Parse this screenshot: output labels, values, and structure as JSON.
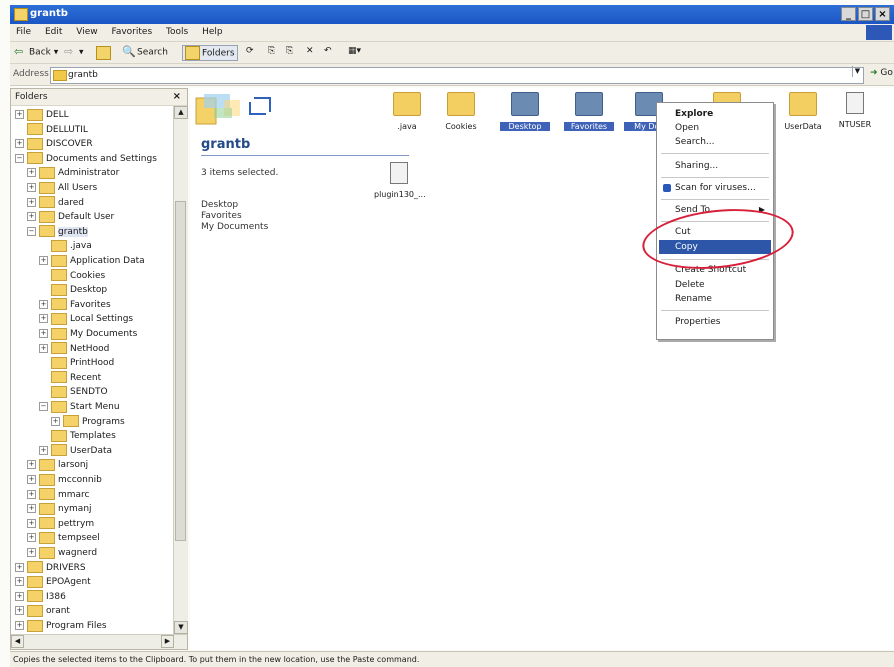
{
  "window": {
    "title": "grantb"
  },
  "menu": [
    "File",
    "Edit",
    "View",
    "Favorites",
    "Tools",
    "Help"
  ],
  "toolbar": {
    "back": "Back",
    "search": "Search",
    "folders": "Folders",
    "views_label": "Views"
  },
  "address": {
    "label": "Address",
    "value": "grantb",
    "go": "Go"
  },
  "folders_pane": {
    "header": "Folders",
    "close": "×",
    "items": [
      {
        "label": "DELL",
        "depth": 0,
        "pm": "+"
      },
      {
        "label": "DELLUTIL",
        "depth": 0,
        "pm": ""
      },
      {
        "label": "DISCOVER",
        "depth": 0,
        "pm": "+"
      },
      {
        "label": "Documents and Settings",
        "depth": 0,
        "pm": "-"
      },
      {
        "label": "Administrator",
        "depth": 1,
        "pm": "+"
      },
      {
        "label": "All Users",
        "depth": 1,
        "pm": "+"
      },
      {
        "label": "dared",
        "depth": 1,
        "pm": "+"
      },
      {
        "label": "Default User",
        "depth": 1,
        "pm": "+"
      },
      {
        "label": "grantb",
        "depth": 1,
        "pm": "-",
        "selected": true
      },
      {
        "label": ".java",
        "depth": 2,
        "pm": ""
      },
      {
        "label": "Application Data",
        "depth": 2,
        "pm": "+"
      },
      {
        "label": "Cookies",
        "depth": 2,
        "pm": ""
      },
      {
        "label": "Desktop",
        "depth": 2,
        "pm": ""
      },
      {
        "label": "Favorites",
        "depth": 2,
        "pm": "+"
      },
      {
        "label": "Local Settings",
        "depth": 2,
        "pm": "+"
      },
      {
        "label": "My Documents",
        "depth": 2,
        "pm": "+"
      },
      {
        "label": "NetHood",
        "depth": 2,
        "pm": "+"
      },
      {
        "label": "PrintHood",
        "depth": 2,
        "pm": ""
      },
      {
        "label": "Recent",
        "depth": 2,
        "pm": ""
      },
      {
        "label": "SENDTO",
        "depth": 2,
        "pm": ""
      },
      {
        "label": "Start Menu",
        "depth": 2,
        "pm": "-"
      },
      {
        "label": "Programs",
        "depth": 3,
        "pm": "+"
      },
      {
        "label": "Templates",
        "depth": 2,
        "pm": ""
      },
      {
        "label": "UserData",
        "depth": 2,
        "pm": "+"
      },
      {
        "label": "larsonj",
        "depth": 1,
        "pm": "+"
      },
      {
        "label": "mcconnib",
        "depth": 1,
        "pm": "+"
      },
      {
        "label": "mmarc",
        "depth": 1,
        "pm": "+"
      },
      {
        "label": "nymanj",
        "depth": 1,
        "pm": "+"
      },
      {
        "label": "pettrym",
        "depth": 1,
        "pm": "+"
      },
      {
        "label": "tempseel",
        "depth": 1,
        "pm": "+"
      },
      {
        "label": "wagnerd",
        "depth": 1,
        "pm": "+"
      },
      {
        "label": "DRIVERS",
        "depth": 0,
        "pm": "+"
      },
      {
        "label": "EPOAgent",
        "depth": 0,
        "pm": "+"
      },
      {
        "label": "I386",
        "depth": 0,
        "pm": "+"
      },
      {
        "label": "orant",
        "depth": 0,
        "pm": "+"
      },
      {
        "label": "Program Files",
        "depth": 0,
        "pm": "+"
      }
    ]
  },
  "content": {
    "folder_title": "grantb",
    "info": "3 items selected.",
    "selected_items": [
      "Desktop",
      "Favorites",
      "My Documents"
    ],
    "files": [
      {
        "label": ".java",
        "type": "folder",
        "highlight": false
      },
      {
        "label": "Cookies",
        "type": "folder",
        "highlight": false
      },
      {
        "label": "Desktop",
        "type": "folder-selected",
        "highlight": true
      },
      {
        "label": "Favorites",
        "type": "folder-selected",
        "highlight": true
      },
      {
        "label": "My Doc",
        "type": "folder-selected",
        "highlight": true
      },
      {
        "label": "",
        "type": "folder",
        "highlight": false
      },
      {
        "label": "UserData",
        "type": "folder",
        "highlight": false
      },
      {
        "label": "NTUSER",
        "type": "doc",
        "highlight": false
      },
      {
        "label": "plugin130_...",
        "type": "doc",
        "highlight": false
      }
    ]
  },
  "context_menu": {
    "explore": "Explore",
    "open": "Open",
    "search": "Search...",
    "sharing": "Sharing...",
    "scan": "Scan for viruses...",
    "send_to": "Send To",
    "cut": "Cut",
    "copy": "Copy",
    "create_shortcut": "Create Shortcut",
    "delete": "Delete",
    "rename": "Rename",
    "properties": "Properties"
  },
  "status": "Copies the selected items to the Clipboard. To put them in the new location, use the Paste command.",
  "colors": {
    "titlebar": "#1b56c4",
    "highlight": "#2e56a8",
    "annotation": "#d8203a"
  }
}
